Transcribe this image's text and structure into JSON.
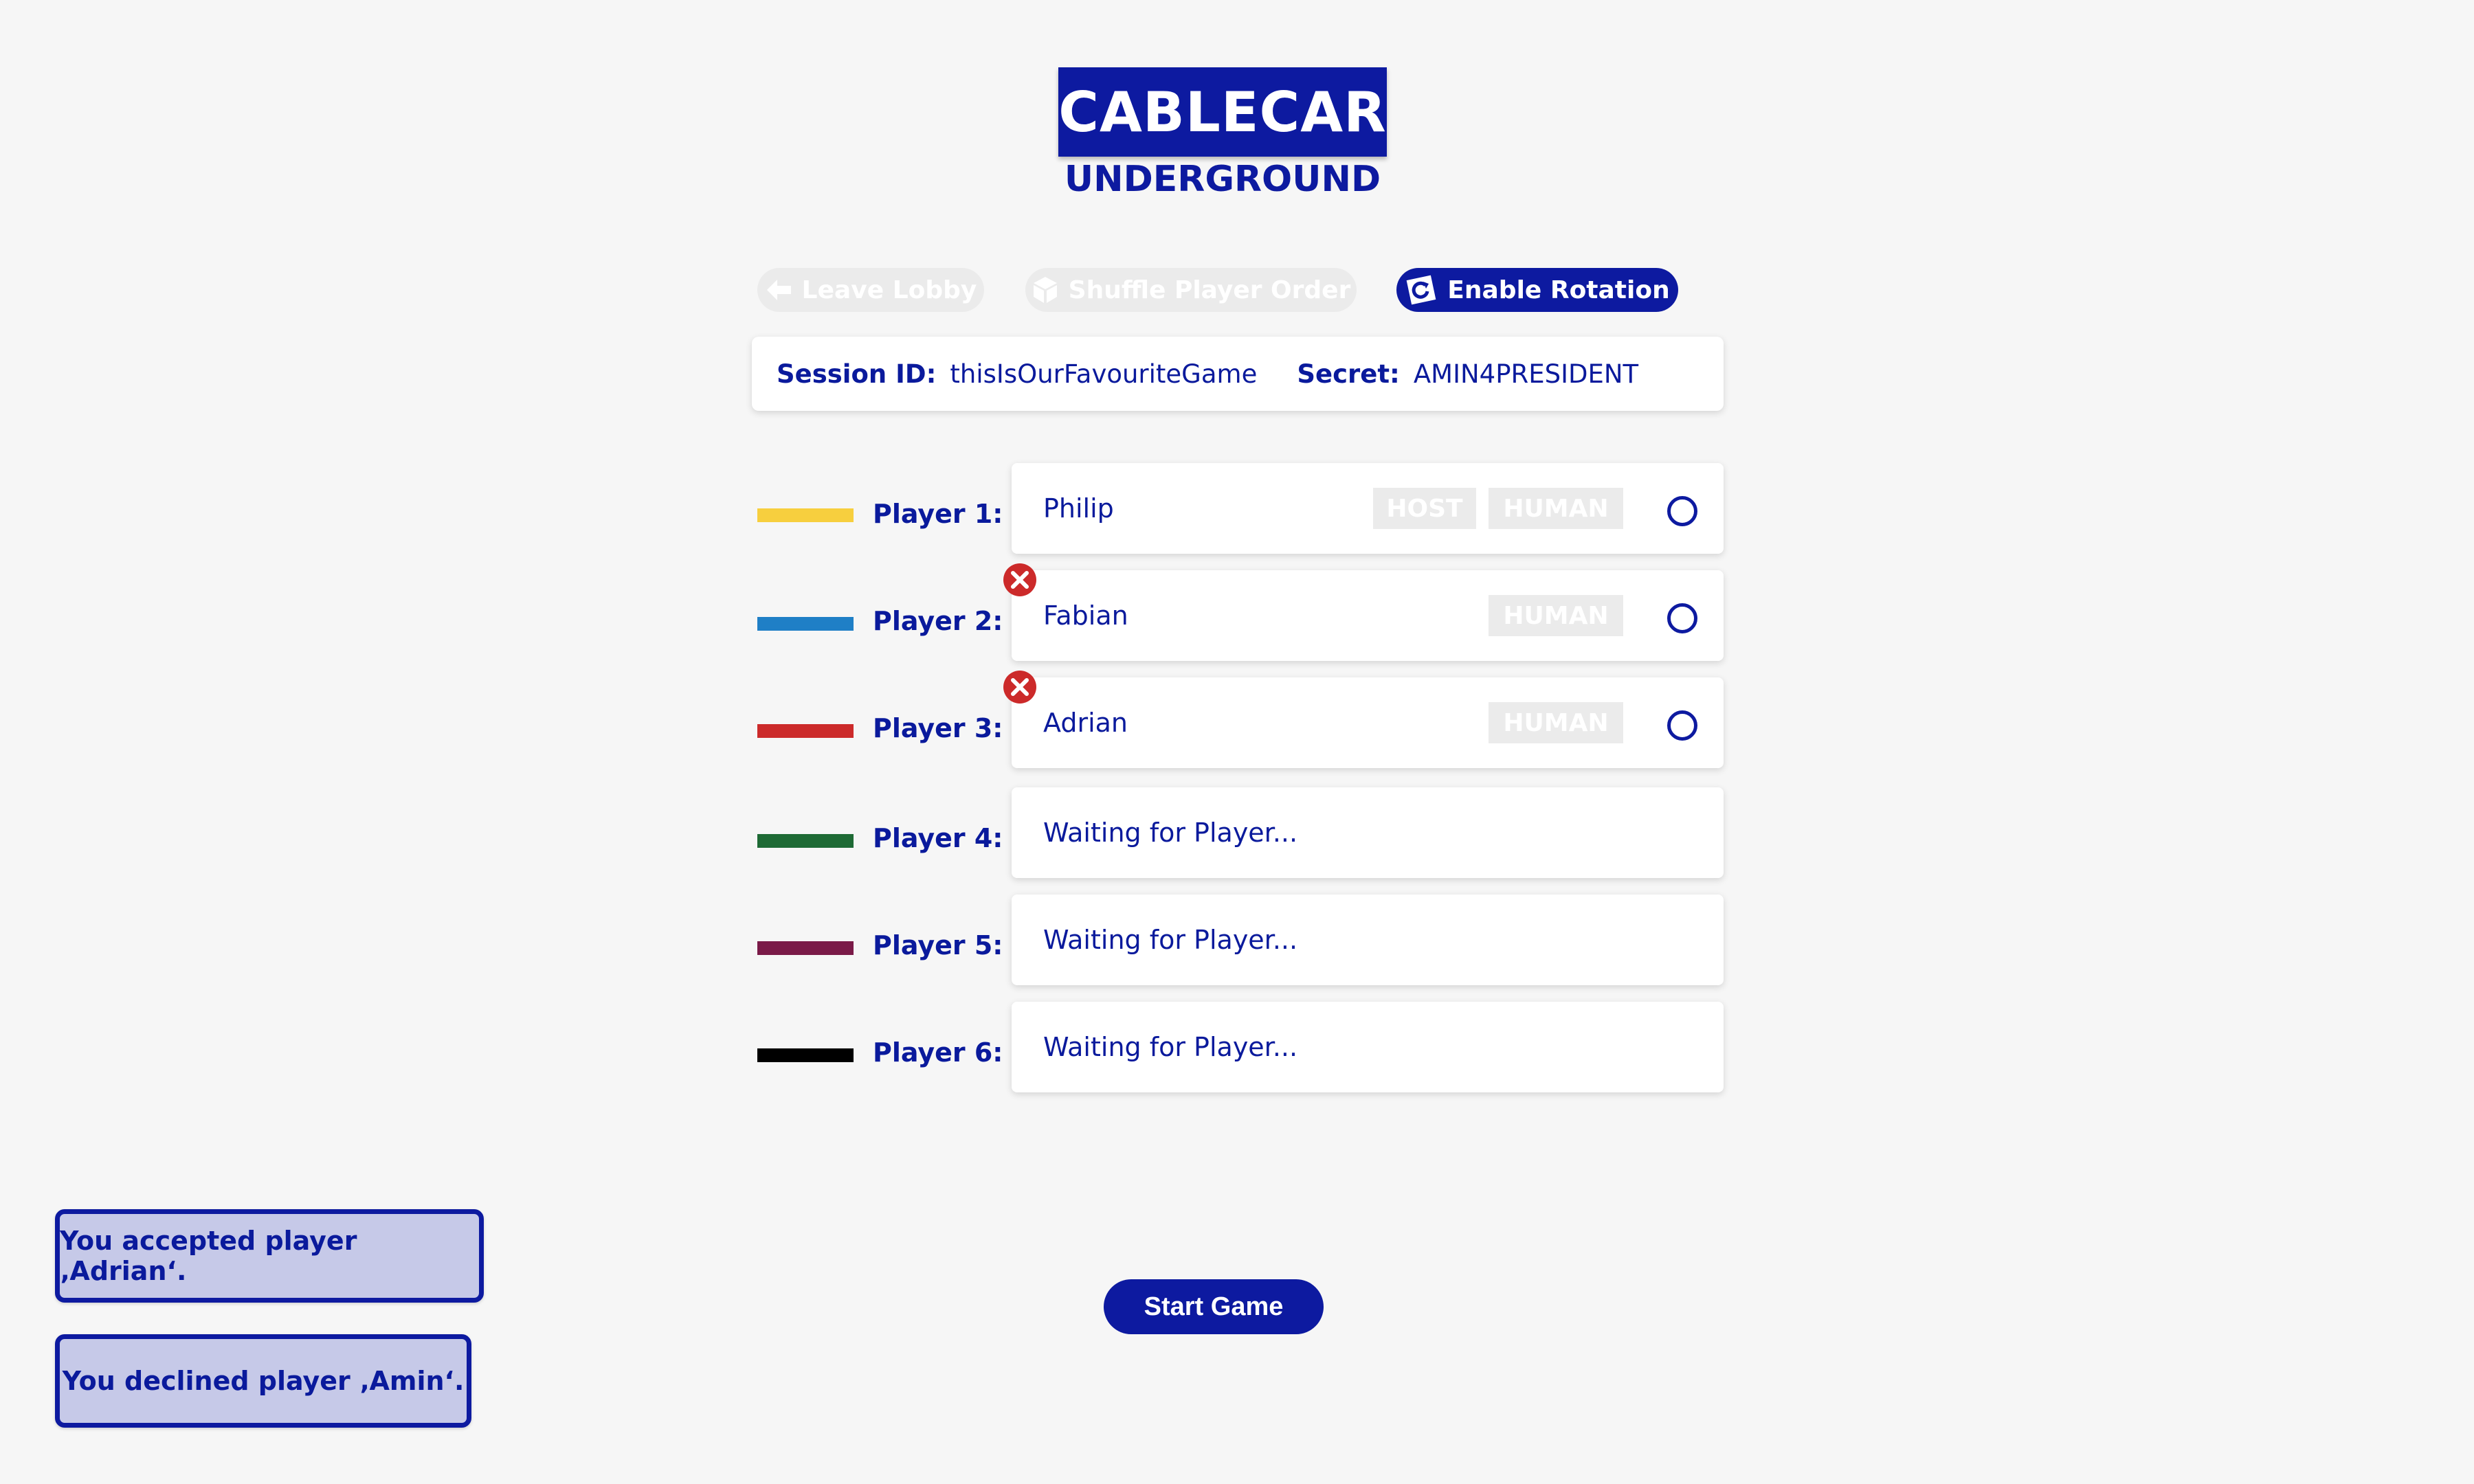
{
  "logo": {
    "title": "CABLECAR",
    "subtitle": "UNDERGROUND"
  },
  "toolbar": {
    "leave_label": "Leave Lobby",
    "shuffle_label": "Shuffle Player Order",
    "rotation_label": "Enable Rotation"
  },
  "session": {
    "id_label": "Session ID:",
    "id_value": "thisIsOurFavouriteGame",
    "secret_label": "Secret:",
    "secret_value": "AMIN4PRESIDENT"
  },
  "players": [
    {
      "label": "Player 1:",
      "name": "Philip",
      "color": "#f7cf3e",
      "tags": [
        "HOST",
        "HUMAN"
      ]
    },
    {
      "label": "Player 2:",
      "name": "Fabian",
      "color": "#1f7fc6",
      "tags": [
        "HUMAN"
      ]
    },
    {
      "label": "Player 3:",
      "name": "Adrian",
      "color": "#cc2a2a",
      "tags": [
        "HUMAN"
      ]
    },
    {
      "label": "Player 4:",
      "name": "Waiting for Player...",
      "color": "#1e6a35",
      "tags": []
    },
    {
      "label": "Player 5:",
      "name": "Waiting for Player...",
      "color": "#7a1a48",
      "tags": []
    },
    {
      "label": "Player 6:",
      "name": "Waiting for Player...",
      "color": "#000000",
      "tags": []
    }
  ],
  "start_label": "Start Game",
  "toasts": [
    {
      "text": "You accepted player ‚Adrian‘."
    },
    {
      "text": "You declined player ‚Amin‘."
    }
  ],
  "colors": {
    "primary": "#0d1aa0",
    "disabled": "#ebebeb",
    "toast_bg": "#c6c9e8",
    "remove": "#cc2a2a"
  }
}
